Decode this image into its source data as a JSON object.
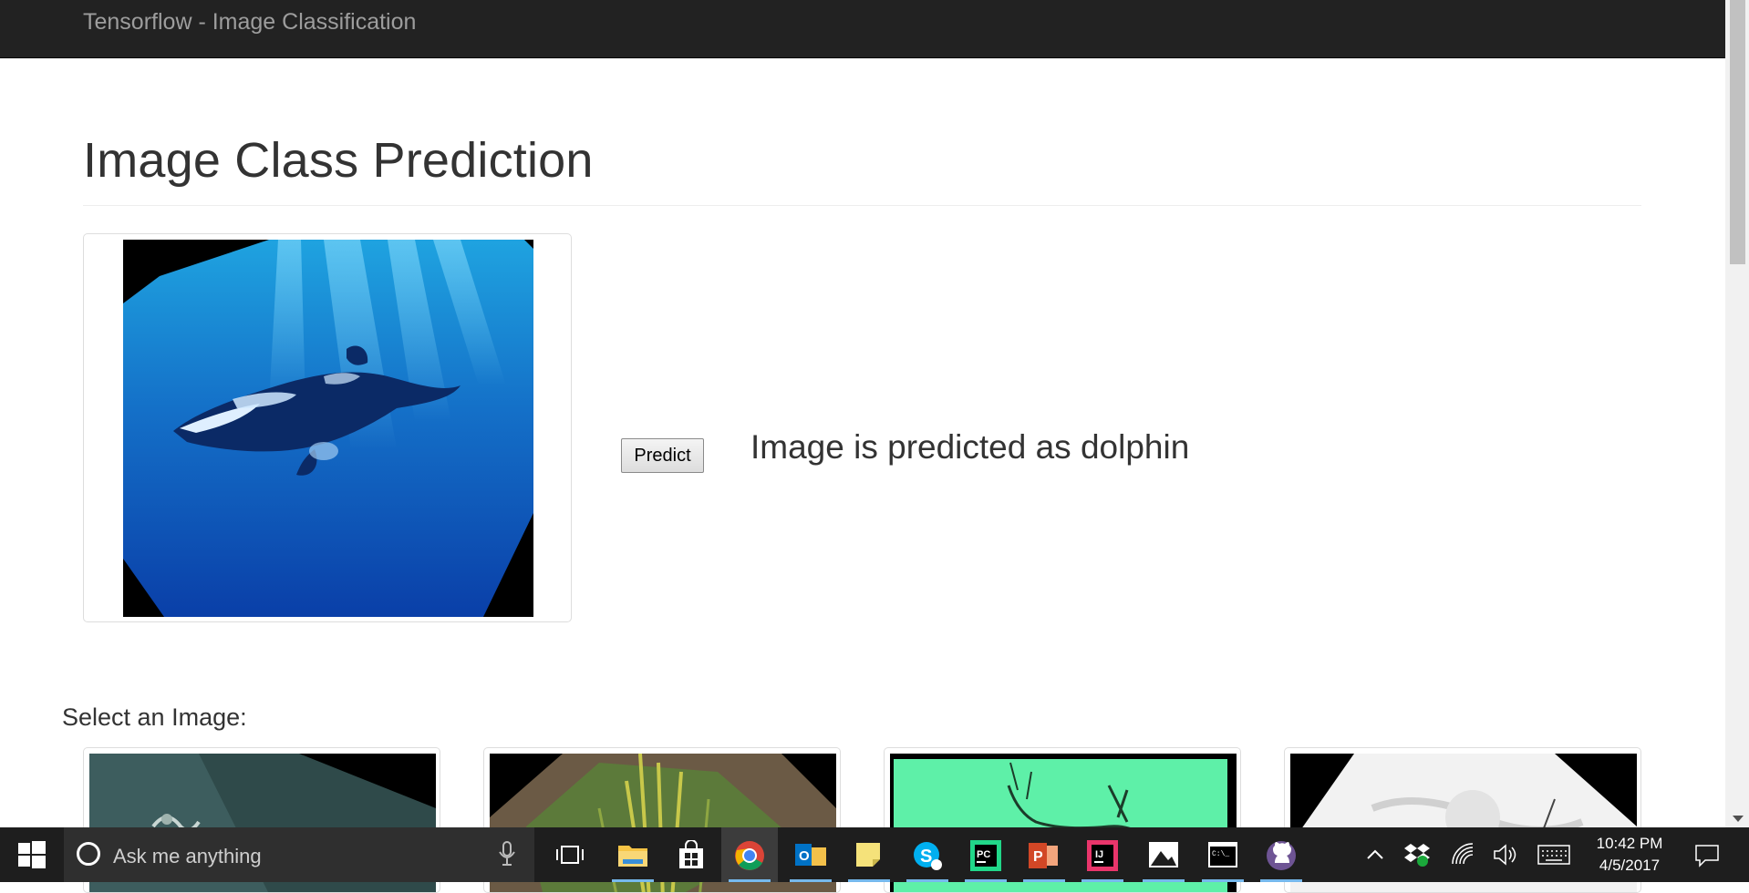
{
  "navbar": {
    "brand": "Tensorflow - Image Classification"
  },
  "main": {
    "title": "Image Class Prediction",
    "predict_button": "Predict",
    "prediction_text": "Image is predicted as dolphin",
    "select_label": "Select an Image:"
  },
  "thumbnails": [
    {
      "name": "image-1"
    },
    {
      "name": "image-2"
    },
    {
      "name": "image-3"
    },
    {
      "name": "image-4"
    }
  ],
  "taskbar": {
    "search_placeholder": "Ask me anything",
    "apps": [
      "task-view",
      "file-explorer",
      "store",
      "chrome",
      "outlook",
      "sticky-notes",
      "skype",
      "pycharm",
      "powerpoint",
      "intellij",
      "photos",
      "command-prompt",
      "github"
    ],
    "clock_time": "10:42 PM",
    "clock_date": "4/5/2017"
  },
  "colors": {
    "navbar_bg": "#222222",
    "brand_text": "#9d9d9d",
    "taskbar_bg": "#1e1e1e",
    "accent": "#76b9ed"
  }
}
